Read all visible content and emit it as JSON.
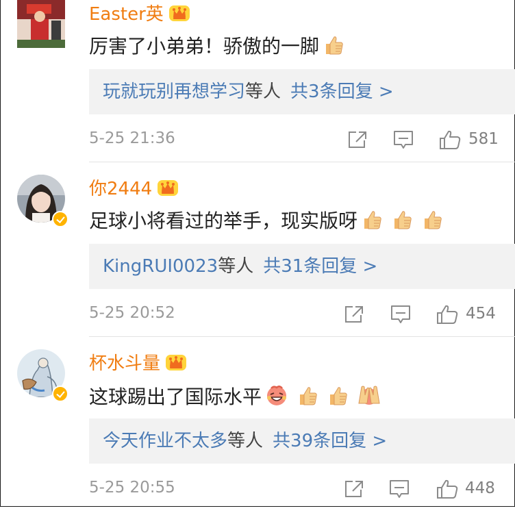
{
  "comments": [
    {
      "username": "Easter英",
      "content": "厉害了小弟弟！骄傲的一脚",
      "reply_users": "玩就玩别再想学习",
      "reply_mid": "等人",
      "reply_count": "共3条回复 >",
      "time": "5-25 21:36",
      "likes": "581",
      "emoji": [
        "thumbs-up"
      ],
      "verified": false
    },
    {
      "username": "你2444",
      "content": "足球小将看过的举手，现实版呀",
      "reply_users": "KingRUI0023",
      "reply_mid": "等人",
      "reply_count": "共31条回复 >",
      "time": "5-25 20:52",
      "likes": "454",
      "emoji": [
        "thumbs-up",
        "thumbs-up",
        "thumbs-up"
      ],
      "verified": true
    },
    {
      "username": "杯水斗量",
      "content": "这球踢出了国际水平",
      "reply_users": "今天作业不太多",
      "reply_mid": "等人",
      "reply_count": "共39条回复 >",
      "time": "5-25 20:55",
      "likes": "448",
      "emoji": [
        "laughing-face",
        "thumbs-up",
        "thumbs-up",
        "victory-hands"
      ],
      "verified": true
    }
  ],
  "colors": {
    "username": "#f07d12",
    "link": "#4b7bb5",
    "meta": "#9a9a9a",
    "reply_bg": "#f2f2f2"
  },
  "icons": [
    "crown-badge-icon",
    "share-icon",
    "comment-icon",
    "like-icon",
    "verified-badge-icon"
  ]
}
